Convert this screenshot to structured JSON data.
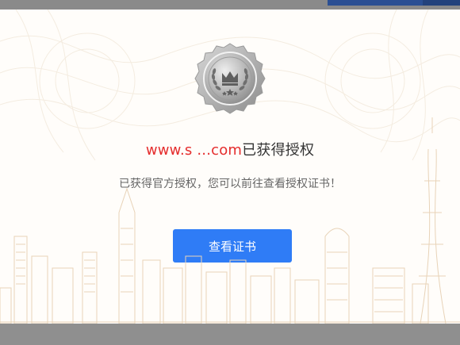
{
  "background": {
    "overlay_color": "#8e8e8e",
    "tab_color": "#2b4f93"
  },
  "modal": {
    "badge_icon": "silver-crown-laurel-badge-icon",
    "title": {
      "domain_text": "www.s        ...com",
      "suffix": "已获得授权",
      "domain_color": "#e52d2d"
    },
    "subtitle": "已获得官方授权，您可以前往查看授权证书！",
    "button": {
      "label": "查看证书",
      "color": "#2f7cf6"
    },
    "illustration": "city-skyline-line-art"
  }
}
